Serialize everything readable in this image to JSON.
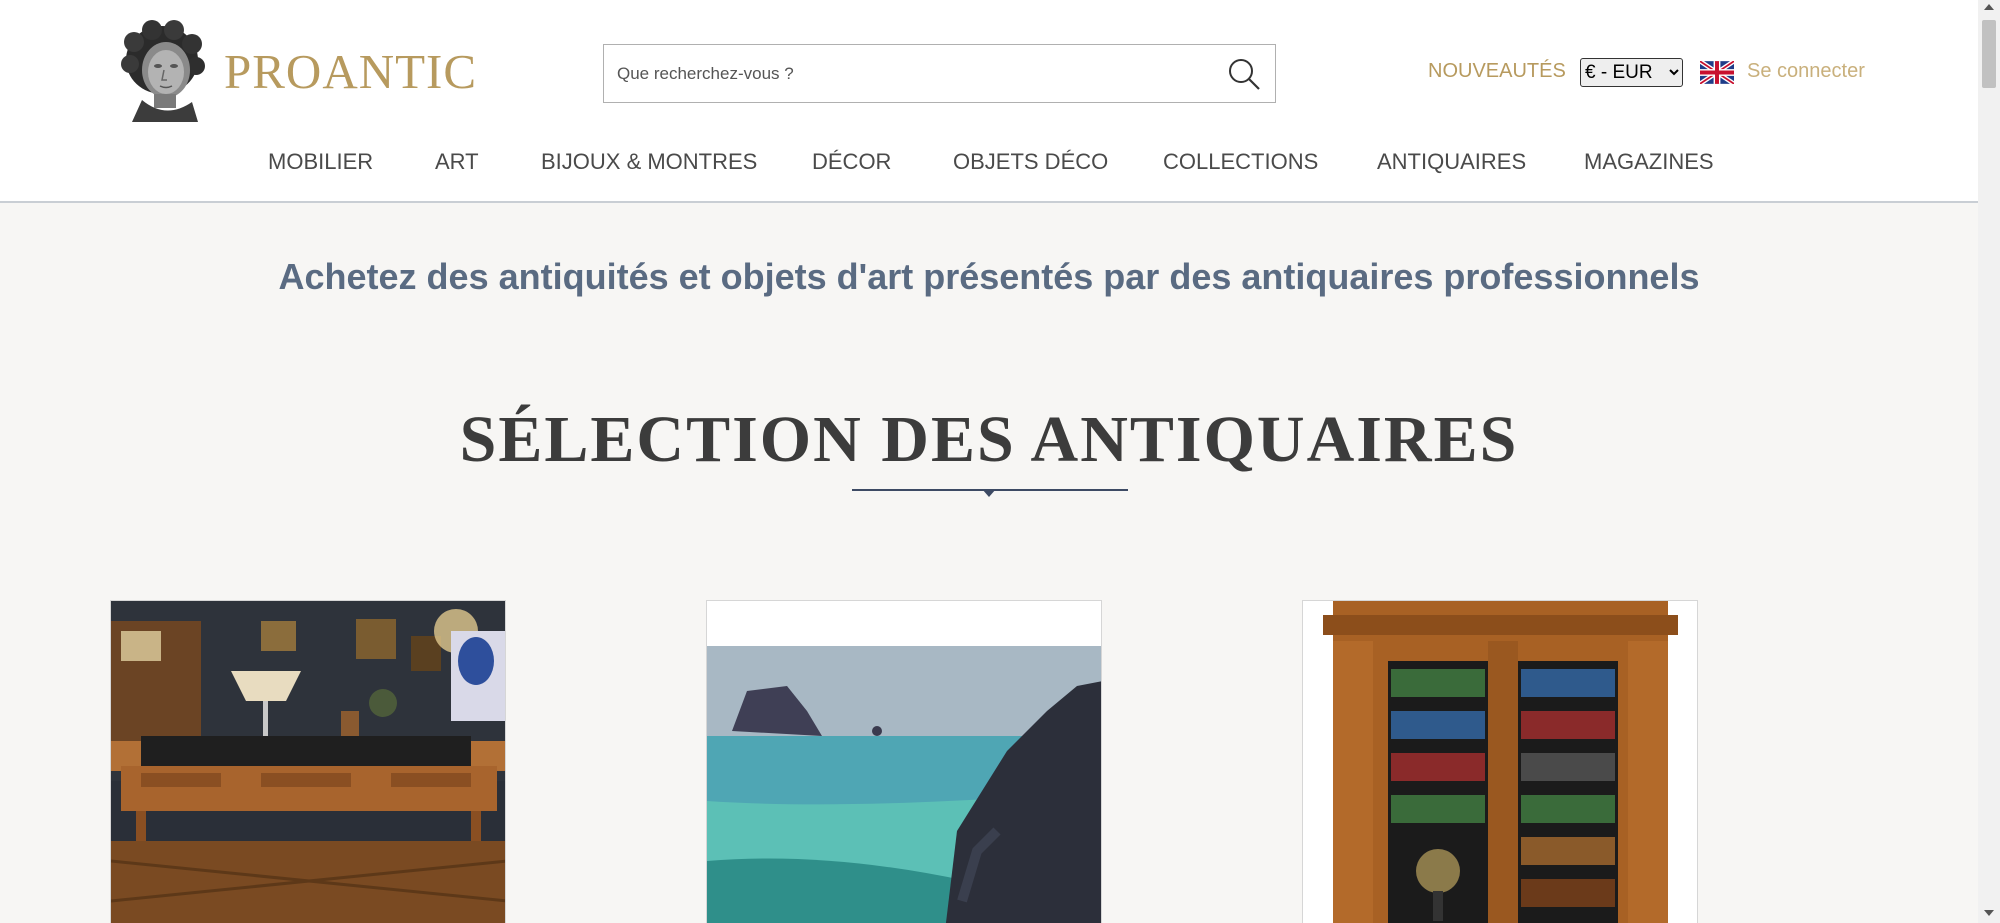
{
  "brand": {
    "name": "PROANTIC",
    "accent_color": "#b79a5e"
  },
  "search": {
    "placeholder": "Que recherchez-vous ?",
    "icon": "search-icon"
  },
  "header_links": {
    "nouveautes": "NOUVEAUTÉS",
    "login": "Se connecter"
  },
  "currency": {
    "selected": "€ - EUR"
  },
  "language_icon": "uk-flag-icon",
  "nav": {
    "items": [
      {
        "label": "MOBILIER"
      },
      {
        "label": "ART"
      },
      {
        "label": "BIJOUX & MONTRES"
      },
      {
        "label": "DÉCOR"
      },
      {
        "label": "OBJETS DÉCO"
      },
      {
        "label": "COLLECTIONS"
      },
      {
        "label": "ANTIQUAIRES"
      },
      {
        "label": "MAGAZINES"
      }
    ]
  },
  "main": {
    "tagline": "Achetez des antiquités et objets d'art présentés par des antiquaires professionnels",
    "section_title": "SÉLECTION DES ANTIQUAIRES"
  },
  "cards": [
    {
      "image": "desk-in-antique-shop"
    },
    {
      "image": "seascape-painting"
    },
    {
      "image": "bookcase-cabinet"
    }
  ]
}
